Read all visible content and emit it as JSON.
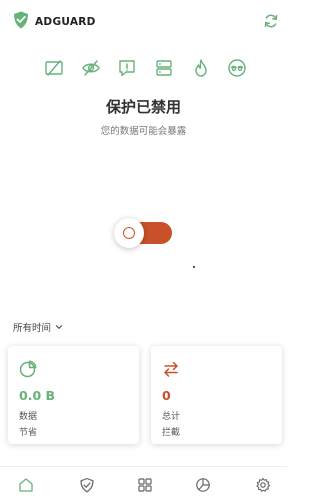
{
  "app": {
    "brand": "ADGUARD",
    "accent_color": "#67b279",
    "disabled_color": "#c8502a"
  },
  "header": {
    "logo_icon": "shield-check-icon",
    "refresh_icon": "refresh-icon"
  },
  "modules": [
    {
      "name": "ad-blocking-icon",
      "label": ""
    },
    {
      "name": "tracking-protection-icon",
      "label": ""
    },
    {
      "name": "annoyance-blocking-icon",
      "label": ""
    },
    {
      "name": "dns-protection-icon",
      "label": ""
    },
    {
      "name": "firewall-icon",
      "label": ""
    },
    {
      "name": "stealth-mode-icon",
      "label": ""
    }
  ],
  "status": {
    "title": "保护已禁用",
    "subtitle": "您的数据可能会暴露",
    "enabled": false
  },
  "stats": {
    "period_label": "所有时间",
    "saved": {
      "value": "0.0 B",
      "label_line1": "数据",
      "label_line2": "节省",
      "icon": "pie-chart-icon"
    },
    "blocked": {
      "value": "0",
      "label_line1": "总计",
      "label_line2": "拦截",
      "icon": "swap-arrows-icon"
    }
  },
  "tabs": [
    {
      "name": "tab-home",
      "icon": "home-icon",
      "active": true
    },
    {
      "name": "tab-protection",
      "icon": "shield-icon",
      "active": false
    },
    {
      "name": "tab-apps",
      "icon": "apps-grid-icon",
      "active": false
    },
    {
      "name": "tab-statistics",
      "icon": "statistics-icon",
      "active": false
    },
    {
      "name": "tab-settings",
      "icon": "gear-icon",
      "active": false
    }
  ]
}
